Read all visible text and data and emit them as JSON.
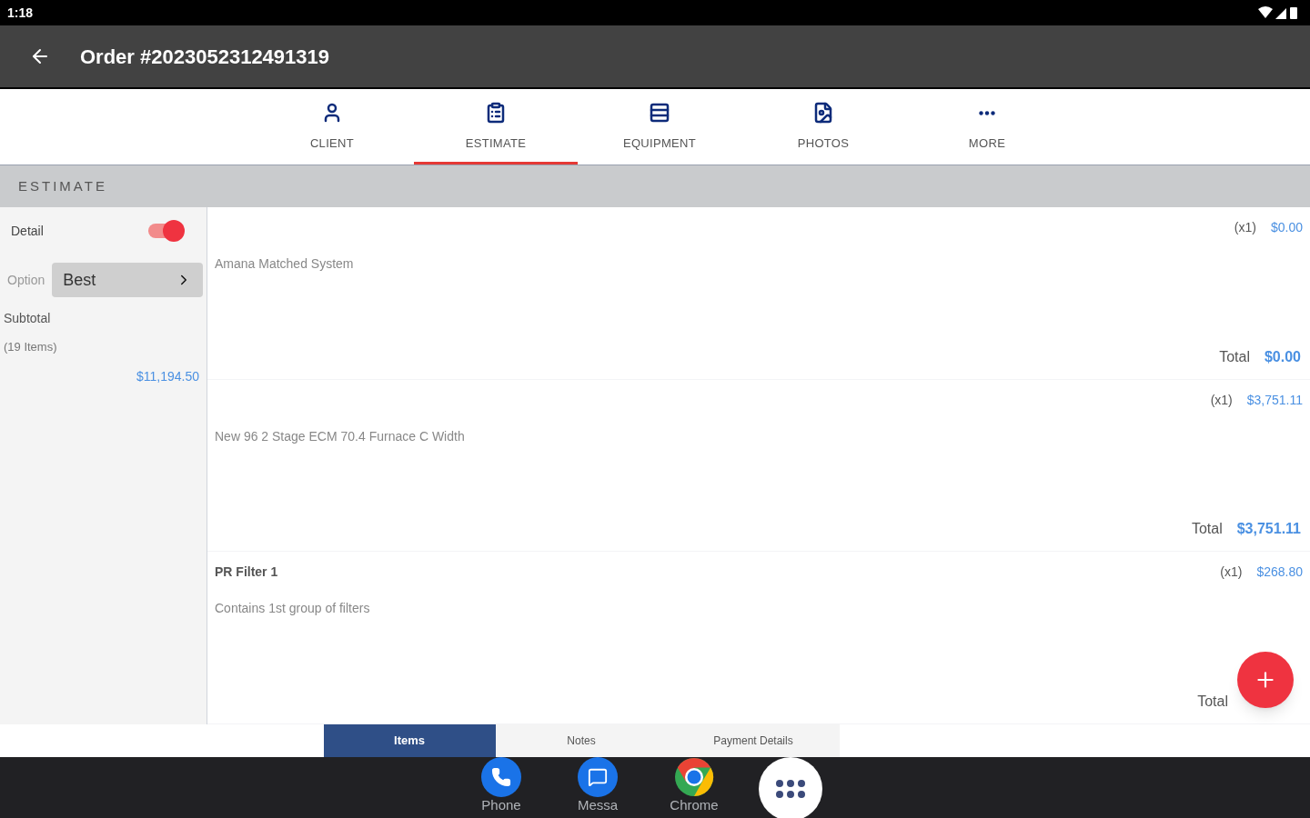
{
  "status_bar": {
    "time": "1:18"
  },
  "app_bar": {
    "title": "Order #2023052312491319"
  },
  "tabs": [
    {
      "label": "CLIENT",
      "selected": false
    },
    {
      "label": "ESTIMATE",
      "selected": true
    },
    {
      "label": "EQUIPMENT",
      "selected": false
    },
    {
      "label": "PHOTOS",
      "selected": false
    },
    {
      "label": "MORE",
      "selected": false
    }
  ],
  "section": {
    "title": "ESTIMATE"
  },
  "sidebar": {
    "detail": {
      "label": "Detail",
      "on": true
    },
    "option": {
      "label": "Option",
      "value": "Best"
    },
    "subtotal": {
      "label": "Subtotal",
      "count": "(19 Items)",
      "amount": "$11,194.50"
    }
  },
  "items": [
    {
      "description": "Amana Matched System",
      "quantity": "(x1)",
      "price": "$0.00",
      "total_label": "Total",
      "total": "$0.00"
    },
    {
      "description": "New 96 2 Stage ECM 70.4 Furnace C Width",
      "quantity": "(x1)",
      "price": "$3,751.11",
      "total_label": "Total",
      "total": "$3,751.11"
    },
    {
      "name": "PR Filter 1",
      "description": "Contains 1st group of filters",
      "quantity": "(x1)",
      "price": "$268.80",
      "total_label": "Total"
    }
  ],
  "bottom_tabs": [
    {
      "label": "Items",
      "selected": true
    },
    {
      "label": "Notes",
      "selected": false
    },
    {
      "label": "Payment Details",
      "selected": false
    }
  ],
  "dock": {
    "apps": [
      {
        "label": "Phone"
      },
      {
        "label": "Messa"
      },
      {
        "label": "Chrome"
      }
    ]
  }
}
